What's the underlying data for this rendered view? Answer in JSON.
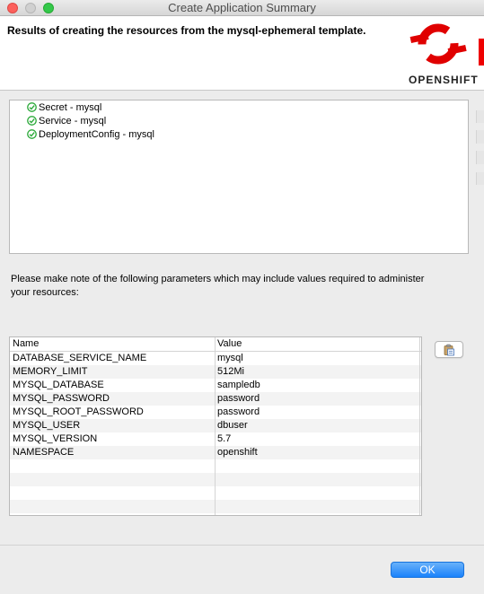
{
  "window": {
    "title": "Create Application Summary"
  },
  "banner": {
    "message": "Results of creating the resources from the mysql-ephemeral template.",
    "logo_text": "OPENSHIFT",
    "logo_color": "#e00000"
  },
  "resources": [
    {
      "label": "Secret - mysql",
      "status_icon": "check-circle-icon"
    },
    {
      "label": "Service - mysql",
      "status_icon": "check-circle-icon"
    },
    {
      "label": "DeploymentConfig - mysql",
      "status_icon": "check-circle-icon"
    }
  ],
  "note": {
    "line1": "Please make note of the following parameters which may include values required to administer",
    "line2": "your resources:"
  },
  "params_table": {
    "headers": {
      "name": "Name",
      "value": "Value"
    },
    "rows": [
      {
        "name": "DATABASE_SERVICE_NAME",
        "value": "mysql"
      },
      {
        "name": "MEMORY_LIMIT",
        "value": "512Mi"
      },
      {
        "name": "MYSQL_DATABASE",
        "value": "sampledb"
      },
      {
        "name": "MYSQL_PASSWORD",
        "value": "password"
      },
      {
        "name": "MYSQL_ROOT_PASSWORD",
        "value": "password"
      },
      {
        "name": "MYSQL_USER",
        "value": "dbuser"
      },
      {
        "name": "MYSQL_VERSION",
        "value": "5.7"
      },
      {
        "name": "NAMESPACE",
        "value": "openshift"
      }
    ]
  },
  "copy_button": {
    "icon": "clipboard-icon"
  },
  "buttons": {
    "ok_label": "OK"
  },
  "colors": {
    "accent": "#1a82fb",
    "success": "#2eaa3c"
  }
}
